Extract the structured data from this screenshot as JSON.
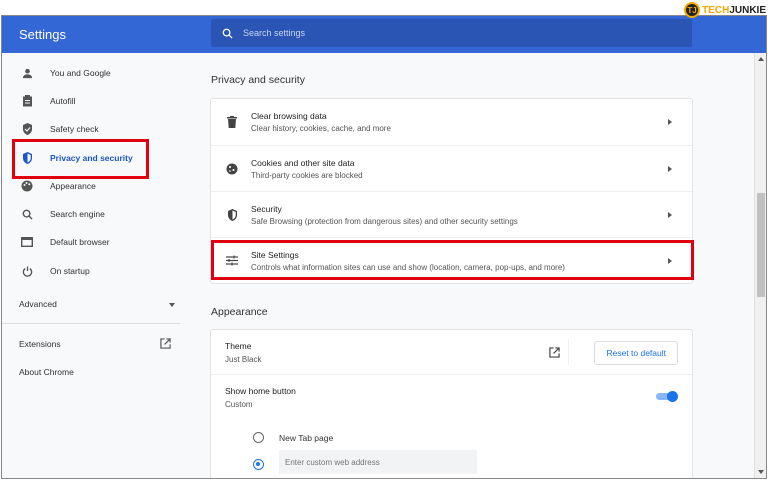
{
  "watermark": {
    "logo_text": "TJ",
    "brand_a": "TECH",
    "brand_b": "JUNKIE"
  },
  "header": {
    "title": "Settings",
    "search_placeholder": "Search settings"
  },
  "sidebar": {
    "items": [
      {
        "label": "You and Google",
        "icon": "person-icon"
      },
      {
        "label": "Autofill",
        "icon": "clipboard-icon"
      },
      {
        "label": "Safety check",
        "icon": "shield-check-icon"
      },
      {
        "label": "Privacy and security",
        "icon": "shield-icon",
        "active": true
      },
      {
        "label": "Appearance",
        "icon": "palette-icon"
      },
      {
        "label": "Search engine",
        "icon": "search-icon"
      },
      {
        "label": "Default browser",
        "icon": "browser-icon"
      },
      {
        "label": "On startup",
        "icon": "power-icon"
      }
    ],
    "advanced": "Advanced",
    "extensions": "Extensions",
    "about": "About Chrome"
  },
  "privacy": {
    "heading": "Privacy and security",
    "rows": [
      {
        "title": "Clear browsing data",
        "subtitle": "Clear history, cookies, cache, and more"
      },
      {
        "title": "Cookies and other site data",
        "subtitle": "Third-party cookies are blocked"
      },
      {
        "title": "Security",
        "subtitle": "Safe Browsing (protection from dangerous sites) and other security settings"
      },
      {
        "title": "Site Settings",
        "subtitle": "Controls what information sites can use and show (location, camera, pop-ups, and more)"
      }
    ]
  },
  "appearance": {
    "heading": "Appearance",
    "theme_title": "Theme",
    "theme_value": "Just Black",
    "reset_label": "Reset to default",
    "home_title": "Show home button",
    "home_value": "Custom",
    "home_enabled": true,
    "radio_newtab": "New Tab page",
    "custom_placeholder": "Enter custom web address"
  },
  "colors": {
    "accent": "#1a73e8",
    "header": "#3367d6",
    "highlight": "#e00010"
  }
}
